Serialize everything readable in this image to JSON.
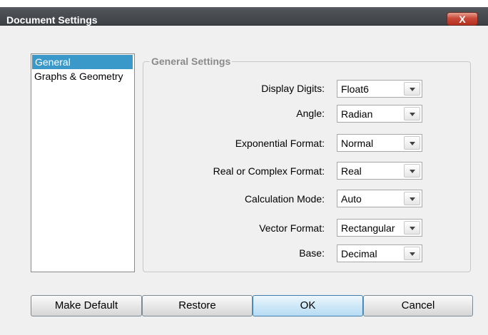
{
  "window": {
    "title": "Document Settings",
    "close_label": "X"
  },
  "categories": [
    {
      "label": "General",
      "selected": true
    },
    {
      "label": "Graphs & Geometry",
      "selected": false
    }
  ],
  "group": {
    "title": "General Settings",
    "rows": [
      {
        "label": "Display Digits:",
        "value": "Float6"
      },
      {
        "label": "Angle:",
        "value": "Radian"
      },
      {
        "label": "Exponential Format:",
        "value": "Normal"
      },
      {
        "label": "Real or Complex Format:",
        "value": "Real"
      },
      {
        "label": "Calculation Mode:",
        "value": "Auto"
      },
      {
        "label": "Vector Format:",
        "value": "Rectangular"
      },
      {
        "label": "Base:",
        "value": "Decimal"
      }
    ]
  },
  "buttons": {
    "make_default": "Make Default",
    "restore": "Restore",
    "ok": "OK",
    "cancel": "Cancel"
  },
  "colors": {
    "selection": "#3a99c9",
    "close_button": "#c9493a",
    "ok_button": "#cfe8f8"
  },
  "icons": {
    "close": "close-icon",
    "dropdown": "chevron-down-icon"
  }
}
